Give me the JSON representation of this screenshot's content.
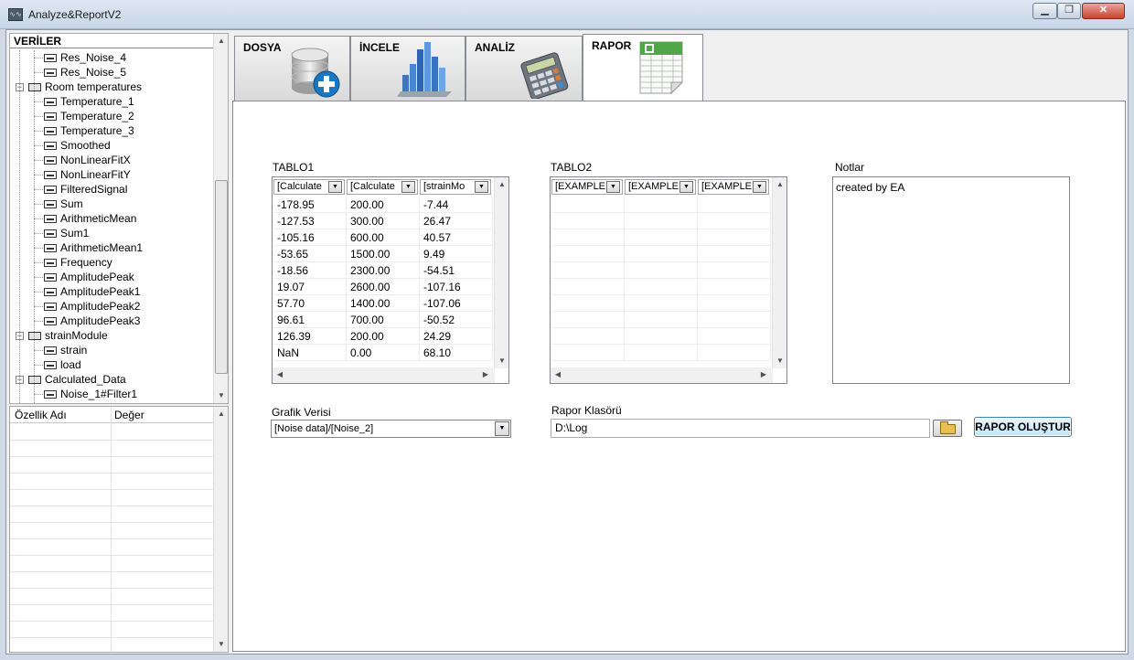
{
  "window": {
    "title": "Analyze&ReportV2",
    "app_icon": "waveform-icon",
    "controls": {
      "minimize": "▁",
      "maximize": "❐",
      "close": "✕"
    }
  },
  "tree": {
    "header": "VERİLER",
    "rows": [
      {
        "label": "Res_Noise_4",
        "level": 2,
        "kind": "signal"
      },
      {
        "label": "Res_Noise_5",
        "level": 2,
        "kind": "signal"
      },
      {
        "label": "Room temperatures",
        "level": 1,
        "kind": "group",
        "expanded": true
      },
      {
        "label": "Temperature_1",
        "level": 2,
        "kind": "signal"
      },
      {
        "label": "Temperature_2",
        "level": 2,
        "kind": "signal"
      },
      {
        "label": "Temperature_3",
        "level": 2,
        "kind": "signal"
      },
      {
        "label": "Smoothed",
        "level": 2,
        "kind": "signal"
      },
      {
        "label": "NonLinearFitX",
        "level": 2,
        "kind": "signal"
      },
      {
        "label": "NonLinearFitY",
        "level": 2,
        "kind": "signal"
      },
      {
        "label": "FilteredSignal",
        "level": 2,
        "kind": "signal"
      },
      {
        "label": "Sum",
        "level": 2,
        "kind": "signal"
      },
      {
        "label": "ArithmeticMean",
        "level": 2,
        "kind": "signal"
      },
      {
        "label": "Sum1",
        "level": 2,
        "kind": "signal"
      },
      {
        "label": "ArithmeticMean1",
        "level": 2,
        "kind": "signal"
      },
      {
        "label": "Frequency",
        "level": 2,
        "kind": "signal"
      },
      {
        "label": "AmplitudePeak",
        "level": 2,
        "kind": "signal"
      },
      {
        "label": "AmplitudePeak1",
        "level": 2,
        "kind": "signal"
      },
      {
        "label": "AmplitudePeak2",
        "level": 2,
        "kind": "signal"
      },
      {
        "label": "AmplitudePeak3",
        "level": 2,
        "kind": "signal"
      },
      {
        "label": "strainModule",
        "level": 1,
        "kind": "group",
        "expanded": true
      },
      {
        "label": "strain",
        "level": 2,
        "kind": "signal"
      },
      {
        "label": "load",
        "level": 2,
        "kind": "signal"
      },
      {
        "label": "Calculated_Data",
        "level": 1,
        "kind": "group",
        "expanded": true
      },
      {
        "label": "Noise_1#Filter1",
        "level": 2,
        "kind": "signal"
      }
    ]
  },
  "properties": {
    "name_header": "Özellik Adı",
    "value_header": "Değer"
  },
  "tabs": [
    {
      "label": "DOSYA",
      "icon": "database-add-icon",
      "active": false
    },
    {
      "label": "İNCELE",
      "icon": "bar-chart-icon",
      "active": false
    },
    {
      "label": "ANALİZ",
      "icon": "calculator-icon",
      "active": false
    },
    {
      "label": "RAPOR",
      "icon": "spreadsheet-icon",
      "active": true
    }
  ],
  "report": {
    "table1": {
      "label": "TABLO1",
      "headers": [
        "[Calculate",
        "[Calculate",
        "[strainMo"
      ],
      "rows": [
        [
          "-178.95",
          "200.00",
          "-7.44"
        ],
        [
          "-127.53",
          "300.00",
          "26.47"
        ],
        [
          "-105.16",
          "600.00",
          "40.57"
        ],
        [
          "-53.65",
          "1500.00",
          "9.49"
        ],
        [
          "-18.56",
          "2300.00",
          "-54.51"
        ],
        [
          "19.07",
          "2600.00",
          "-107.16"
        ],
        [
          "57.70",
          "1400.00",
          "-107.06"
        ],
        [
          "96.61",
          "700.00",
          "-50.52"
        ],
        [
          "126.39",
          "200.00",
          "24.29"
        ],
        [
          "NaN",
          "0.00",
          "68.10"
        ]
      ]
    },
    "table2": {
      "label": "TABLO2",
      "headers": [
        "[EXAMPLE",
        "[EXAMPLE",
        "[EXAMPLE"
      ]
    },
    "notes": {
      "label": "Notlar",
      "value": "created by EA"
    },
    "graph": {
      "label": "Grafik Verisi",
      "selected": "[Noise data]/[Noise_2]"
    },
    "folder": {
      "label": "Rapor Klasörü",
      "value": "D:\\Log",
      "browse_icon": "folder-open-icon"
    },
    "create_button": "RAPOR OLUŞTUR"
  },
  "colors": {
    "titlebar": "#dfe8f3",
    "close_button": "#c8432e",
    "primary_button": "#bee6fd"
  }
}
